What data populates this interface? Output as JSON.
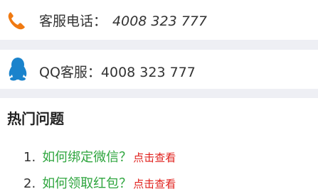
{
  "contact": {
    "phone": {
      "icon": "phone-icon",
      "label": "客服电话：",
      "number": "4008 323 777",
      "icon_color": "#f07a12"
    },
    "qq": {
      "icon": "qq-penguin-icon",
      "label": "QQ客服：4008 323 777",
      "icon_color": "#1a83cc"
    }
  },
  "faq": {
    "title": "热门问题",
    "items": [
      {
        "number": "1.",
        "question": "如何绑定微信？",
        "action": "点击查看"
      },
      {
        "number": "2.",
        "question": "如何领取红包？",
        "action": "点击查看"
      }
    ]
  },
  "colors": {
    "separator": "#eeeff4",
    "question": "#2ea53e",
    "action": "#e0211d"
  }
}
